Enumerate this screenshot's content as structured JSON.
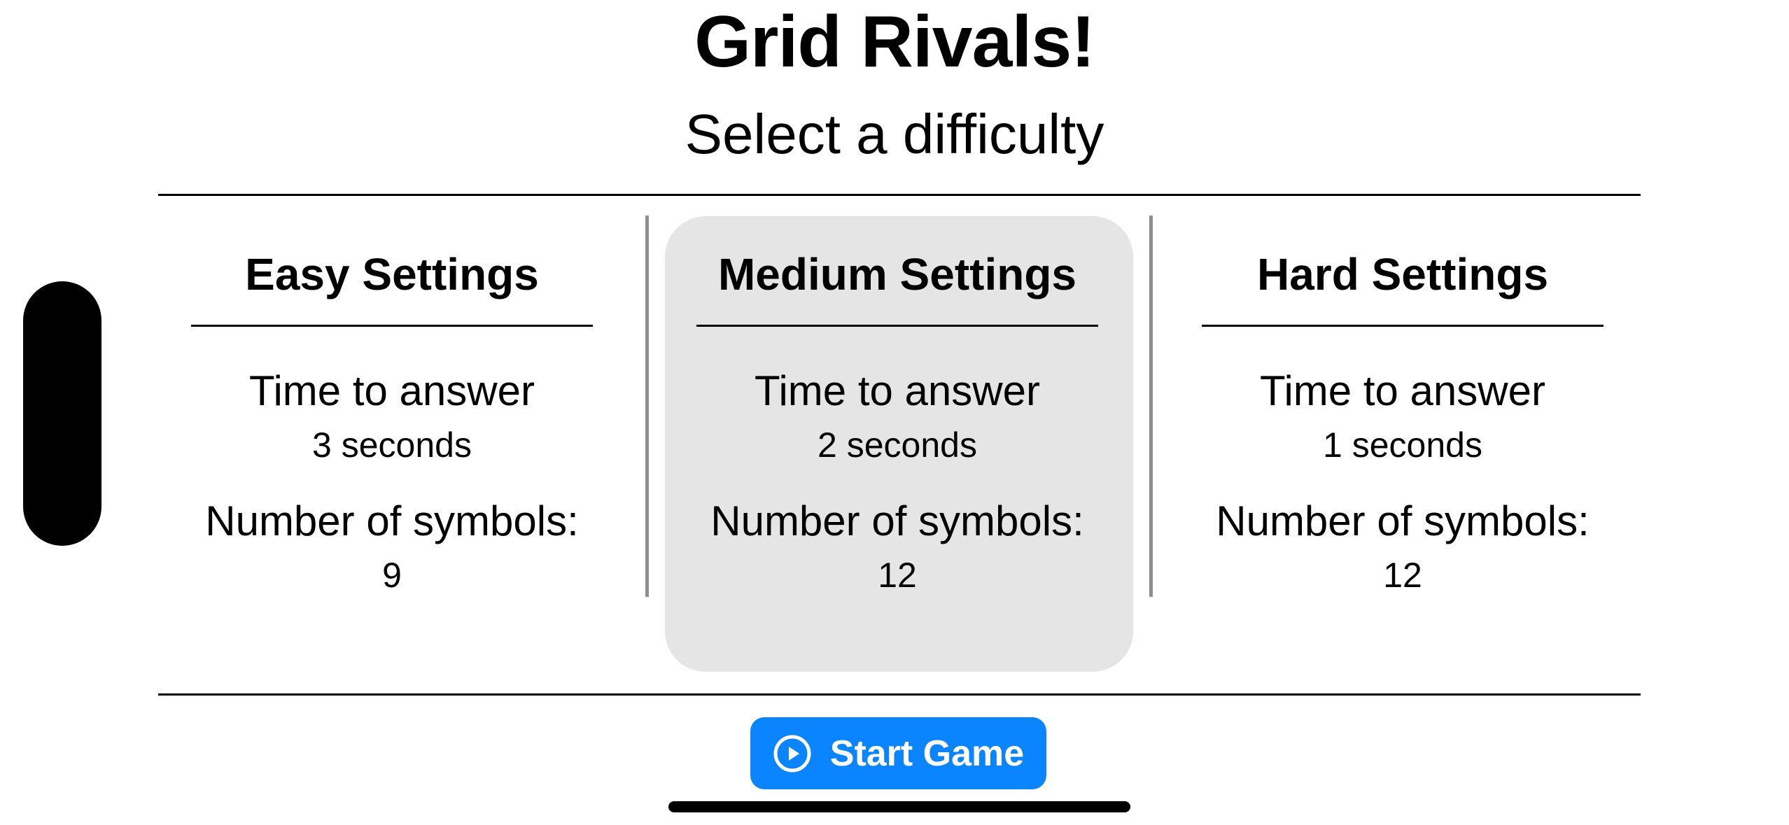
{
  "app": {
    "title": "Grid Rivals!",
    "subtitle": "Select a difficulty"
  },
  "difficulties": [
    {
      "heading": "Easy Settings",
      "time_label": "Time to answer",
      "time_value": "3 seconds",
      "symbols_label": "Number of symbols:",
      "symbols_value": "9",
      "selected": false
    },
    {
      "heading": "Medium Settings",
      "time_label": "Time to answer",
      "time_value": "2 seconds",
      "symbols_label": "Number of symbols:",
      "symbols_value": "12",
      "selected": true
    },
    {
      "heading": "Hard Settings",
      "time_label": "Time to answer",
      "time_value": "1 seconds",
      "symbols_label": "Number of symbols:",
      "symbols_value": "12",
      "selected": false
    }
  ],
  "start_button": {
    "label": "Start Game",
    "icon": "play-circle-icon"
  },
  "colors": {
    "accent": "#0a84ff",
    "selected_background": "#e5e5e5",
    "divider": "#8e8e8e"
  }
}
